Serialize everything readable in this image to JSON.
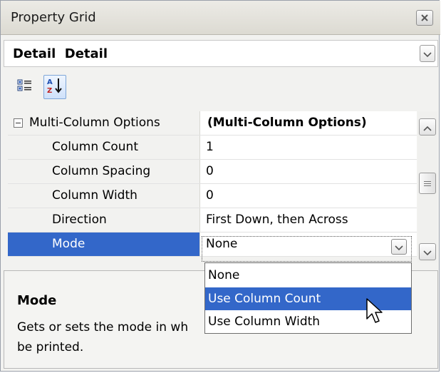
{
  "panel": {
    "title": "Property Grid"
  },
  "object_selector": {
    "text": "Detail  Detail"
  },
  "toolbar": {
    "categorized_icon": "categorized-icon",
    "alphabetical_icon": "sort-alphabetical-icon"
  },
  "grid": {
    "category": {
      "name": "Multi-Column Options",
      "value": "(Multi-Column Options)"
    },
    "rows": [
      {
        "name": "Column Count",
        "value": "1"
      },
      {
        "name": "Column Spacing",
        "value": "0"
      },
      {
        "name": "Column Width",
        "value": "0"
      },
      {
        "name": "Direction",
        "value": "First Down, then Across"
      },
      {
        "name": "Mode",
        "value": "None"
      }
    ]
  },
  "dropdown": {
    "options": [
      "None",
      "Use Column Count",
      "Use Column Width"
    ],
    "highlighted": "Use Column Count"
  },
  "description": {
    "title": "Mode",
    "text": "Gets or sets the mode in wh",
    "text_line2": "be printed."
  },
  "colors": {
    "selection": "#3367c9",
    "panel_bg": "#f2f2f0"
  }
}
